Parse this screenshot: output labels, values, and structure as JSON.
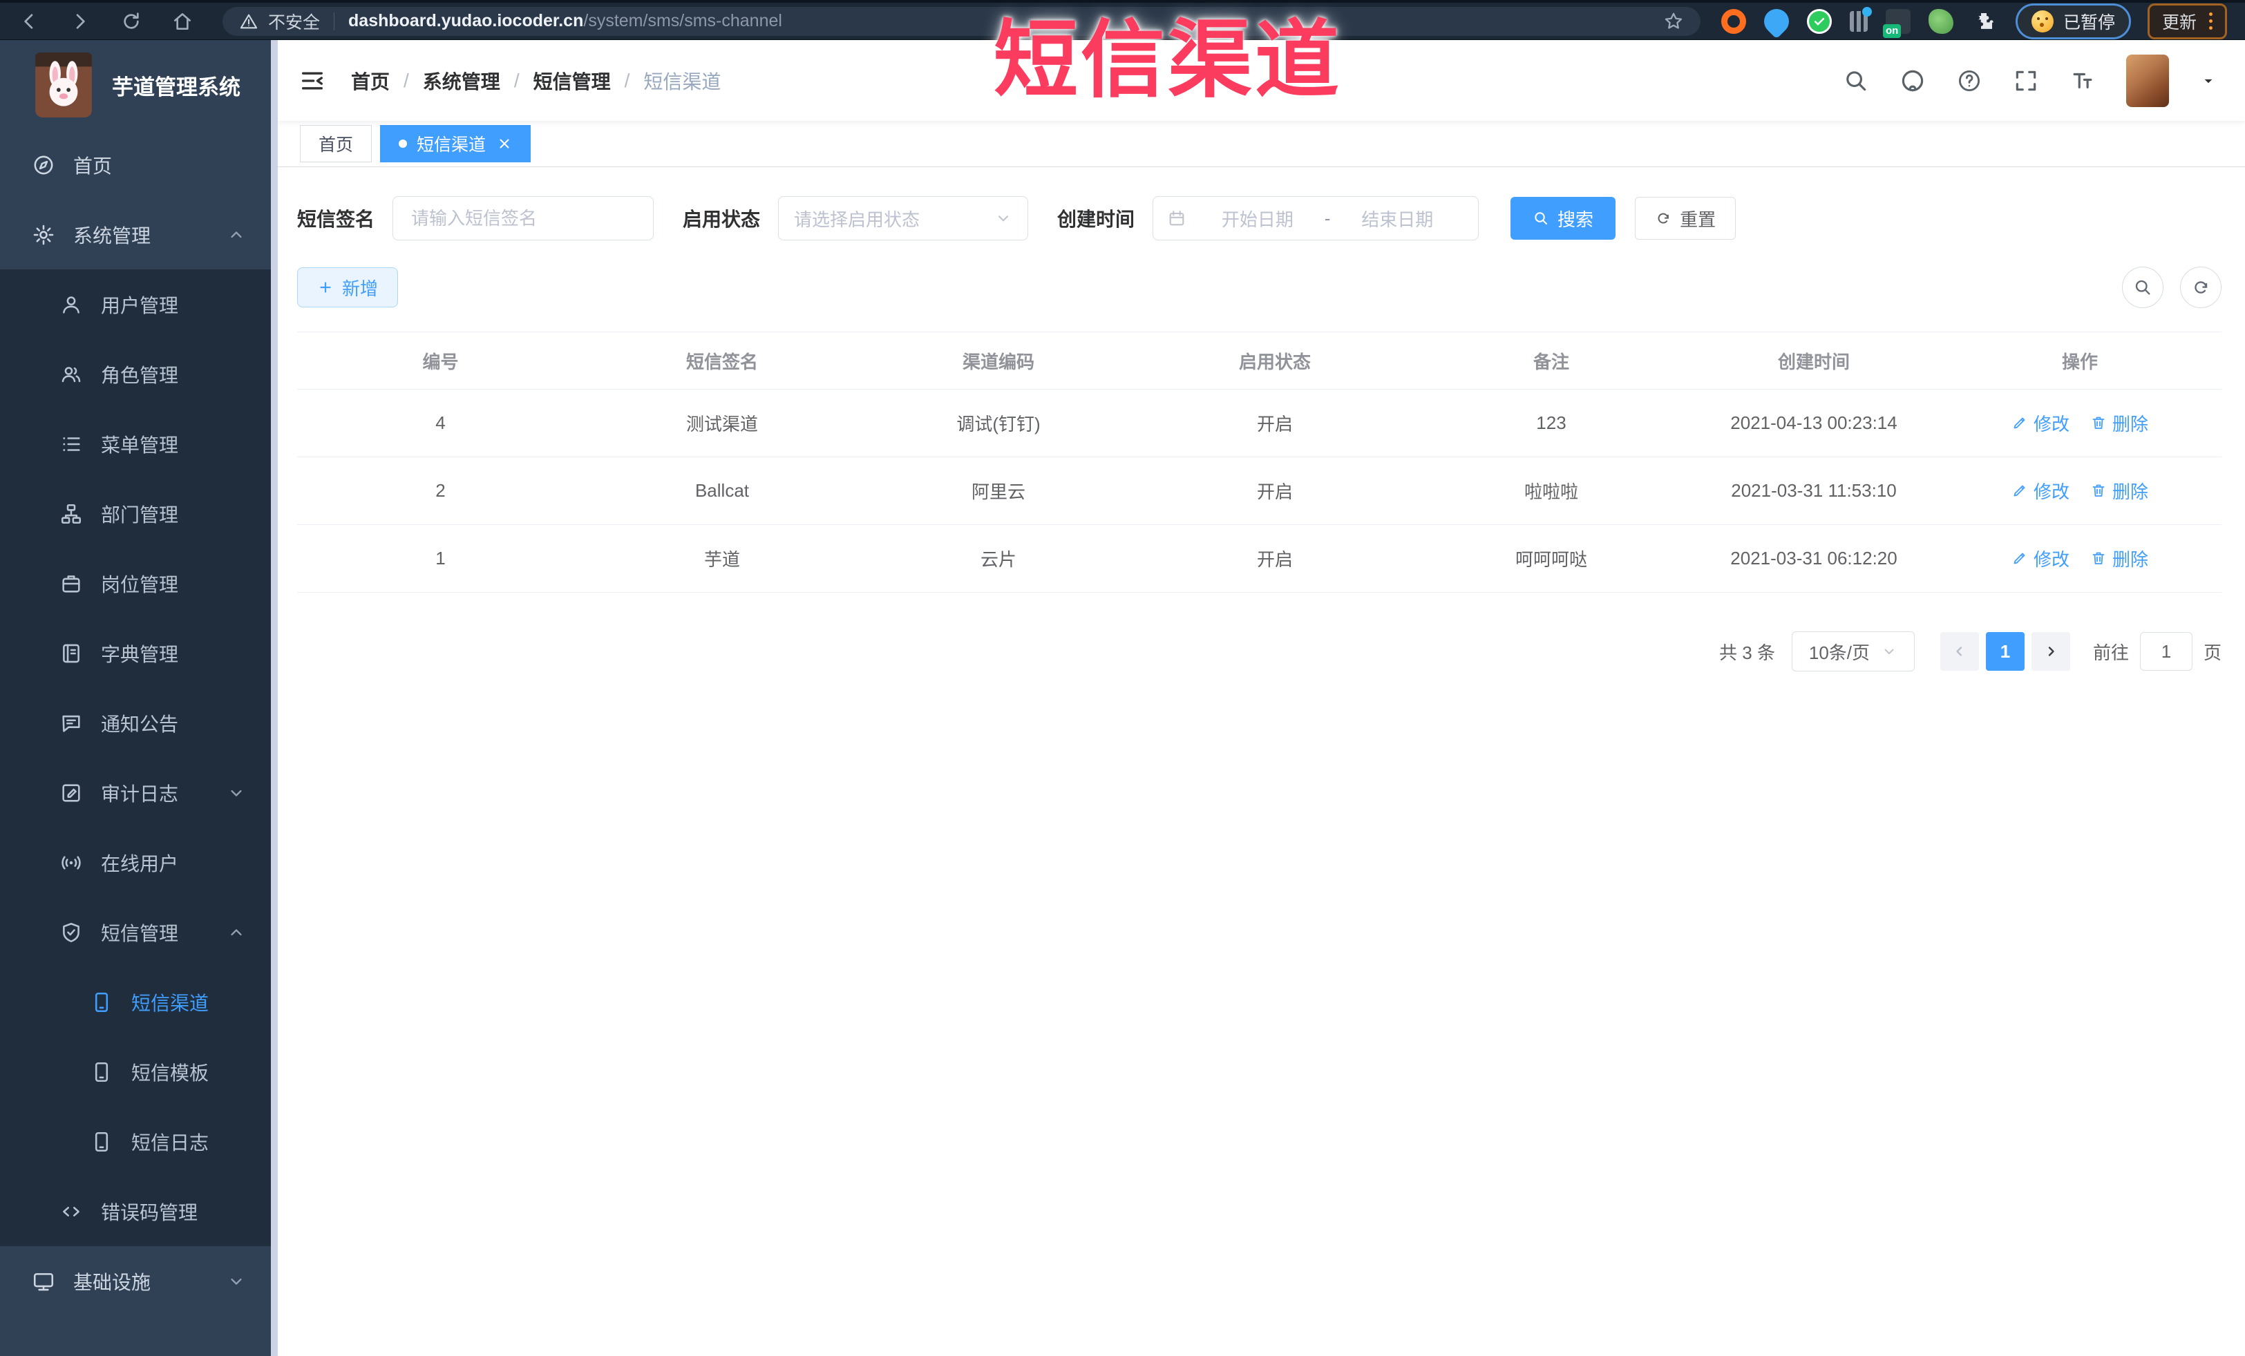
{
  "colors": {
    "primary": "#409eff",
    "overlay_red": "#fb3c5f",
    "sidebar_bg": "#304156",
    "submenu_bg": "#1f2d3d",
    "browser_bar_bg": "#1d2836"
  },
  "overlay_label": "短信渠道",
  "browser": {
    "security_label": "不安全",
    "url_host": "dashboard.yudao.iocoder.cn",
    "url_path": "/system/sms/sms-channel",
    "paused_label": "已暂停",
    "update_label": "更新",
    "extensions": [
      "orange-ring-extension-icon",
      "location-pin-extension-icon",
      "green-check-extension-icon",
      "audio-mixer-extension-icon",
      "vpn-on-extension-icon",
      "plant-extension-icon",
      "extensions-puzzle-icon"
    ]
  },
  "sidebar": {
    "app_title": "芋道管理系统",
    "items": [
      {
        "label": "首页",
        "icon": "home-dashboard-icon",
        "level": 1
      },
      {
        "label": "系统管理",
        "icon": "gear-icon",
        "level": 1,
        "arrow": "up"
      },
      {
        "label": "用户管理",
        "icon": "user-icon",
        "level": 2,
        "dark": true
      },
      {
        "label": "角色管理",
        "icon": "roles-icon",
        "level": 2,
        "dark": true
      },
      {
        "label": "菜单管理",
        "icon": "menu-list-icon",
        "level": 2,
        "dark": true
      },
      {
        "label": "部门管理",
        "icon": "org-tree-icon",
        "level": 2,
        "dark": true
      },
      {
        "label": "岗位管理",
        "icon": "post-badge-icon",
        "level": 2,
        "dark": true
      },
      {
        "label": "字典管理",
        "icon": "dict-book-icon",
        "level": 2,
        "dark": true
      },
      {
        "label": "通知公告",
        "icon": "notice-chat-icon",
        "level": 2,
        "dark": true
      },
      {
        "label": "审计日志",
        "icon": "audit-log-icon",
        "level": 2,
        "dark": true,
        "arrow": "down"
      },
      {
        "label": "在线用户",
        "icon": "online-user-icon",
        "level": 2,
        "dark": true
      },
      {
        "label": "短信管理",
        "icon": "sms-shield-icon",
        "level": 2,
        "dark": true,
        "arrow": "up"
      },
      {
        "label": "短信渠道",
        "icon": "sms-phone-icon",
        "level": 3,
        "dark": true,
        "active": true
      },
      {
        "label": "短信模板",
        "icon": "sms-phone-icon",
        "level": 3,
        "dark": true
      },
      {
        "label": "短信日志",
        "icon": "sms-phone-icon",
        "level": 3,
        "dark": true
      },
      {
        "label": "错误码管理",
        "icon": "error-code-icon",
        "level": 2,
        "dark": true
      },
      {
        "label": "基础设施",
        "icon": "infra-monitor-icon",
        "level": 1,
        "arrow": "down"
      }
    ]
  },
  "header": {
    "breadcrumb": [
      "首页",
      "系统管理",
      "短信管理",
      "短信渠道"
    ]
  },
  "tabs": [
    {
      "label": "首页",
      "active": false
    },
    {
      "label": "短信渠道",
      "active": true,
      "closable": true
    }
  ],
  "filters": {
    "sign_label": "短信签名",
    "sign_placeholder": "请输入短信签名",
    "status_label": "启用状态",
    "status_placeholder": "请选择启用状态",
    "time_label": "创建时间",
    "start_placeholder": "开始日期",
    "range_separator": "-",
    "end_placeholder": "结束日期",
    "search_label": "搜索",
    "reset_label": "重置"
  },
  "toolbar": {
    "add_label": "新增"
  },
  "table": {
    "columns": [
      "编号",
      "短信签名",
      "渠道编码",
      "启用状态",
      "备注",
      "创建时间",
      "操作"
    ],
    "rows": [
      {
        "id": "4",
        "sign": "测试渠道",
        "code": "调试(钉钉)",
        "status": "开启",
        "remark": "123",
        "created": "2021-04-13 00:23:14"
      },
      {
        "id": "2",
        "sign": "Ballcat",
        "code": "阿里云",
        "status": "开启",
        "remark": "啦啦啦",
        "created": "2021-03-31 11:53:10"
      },
      {
        "id": "1",
        "sign": "芋道",
        "code": "云片",
        "status": "开启",
        "remark": "呵呵呵哒",
        "created": "2021-03-31 06:12:20"
      }
    ],
    "edit_label": "修改",
    "delete_label": "删除"
  },
  "pagination": {
    "total_label": "共 3 条",
    "page_size_label": "10条/页",
    "current_page": "1",
    "goto_label": "前往",
    "goto_value": "1",
    "unit_label": "页"
  }
}
